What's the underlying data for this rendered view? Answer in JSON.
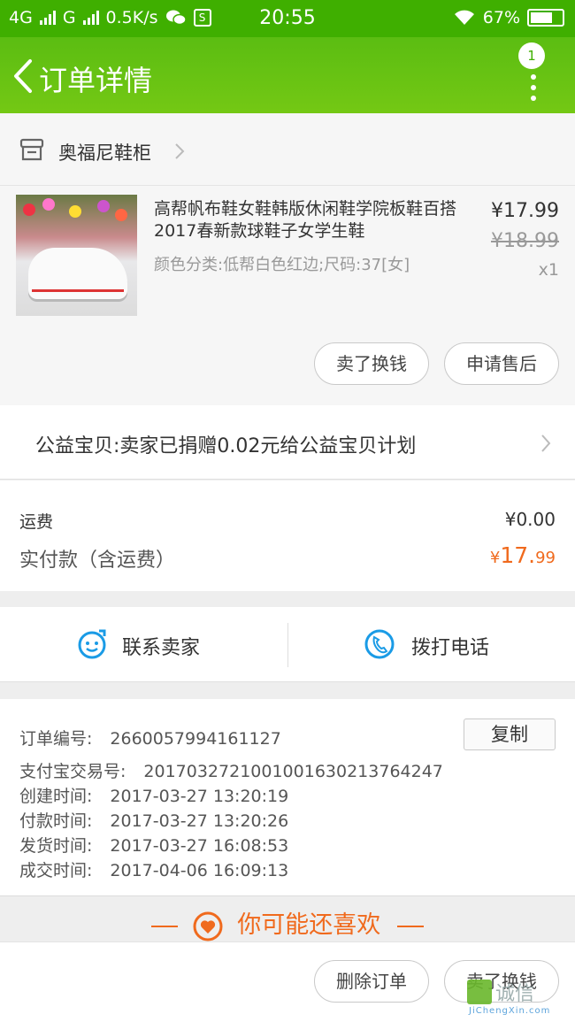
{
  "status_bar": {
    "network1": "4G",
    "network2": "G",
    "speed": "0.5K/s",
    "time": "20:55",
    "battery": "67%"
  },
  "header": {
    "title": "订单详情",
    "badge_count": "1"
  },
  "shop": {
    "name": "奥福尼鞋柜"
  },
  "product": {
    "name": "高帮帆布鞋女鞋韩版休闲鞋学院板鞋百搭2017春新款球鞋子女学生鞋",
    "spec": "颜色分类:低帮白色红边;尺码:37[女]",
    "price": "¥17.99",
    "original_price": "¥18.99",
    "quantity": "x1",
    "btn_sell": "卖了换钱",
    "btn_aftersale": "申请售后"
  },
  "charity": {
    "text": "公益宝贝:卖家已捐赠0.02元给公益宝贝计划"
  },
  "fees": {
    "shipping_label": "运费",
    "shipping_value": "¥0.00",
    "paid_label": "实付款（含运费）",
    "paid_currency": "¥",
    "paid_int": "17.",
    "paid_dec": "99"
  },
  "contact": {
    "seller_label": "联系卖家",
    "call_label": "拨打电话"
  },
  "order_info": {
    "copy_label": "复制",
    "rows": [
      {
        "label": "订单编号:",
        "value": "2660057994161127"
      },
      {
        "label": "支付宝交易号:",
        "value": "2017032721001001630213764247"
      },
      {
        "label": "创建时间:",
        "value": "2017-03-27 13:20:19"
      },
      {
        "label": "付款时间:",
        "value": "2017-03-27 13:20:26"
      },
      {
        "label": "发货时间:",
        "value": "2017-03-27 16:08:53"
      },
      {
        "label": "成交时间:",
        "value": "2017-04-06 16:09:13"
      }
    ]
  },
  "recommend": {
    "title": "你可能还喜欢"
  },
  "bottom": {
    "btn_delete": "删除订单",
    "btn_sell": "卖了换钱"
  },
  "watermark": {
    "text": "诚信",
    "sub": "JiChengXin.com"
  },
  "colors": {
    "brand_green": "#5bbd12",
    "accent_orange": "#f06a1d"
  }
}
